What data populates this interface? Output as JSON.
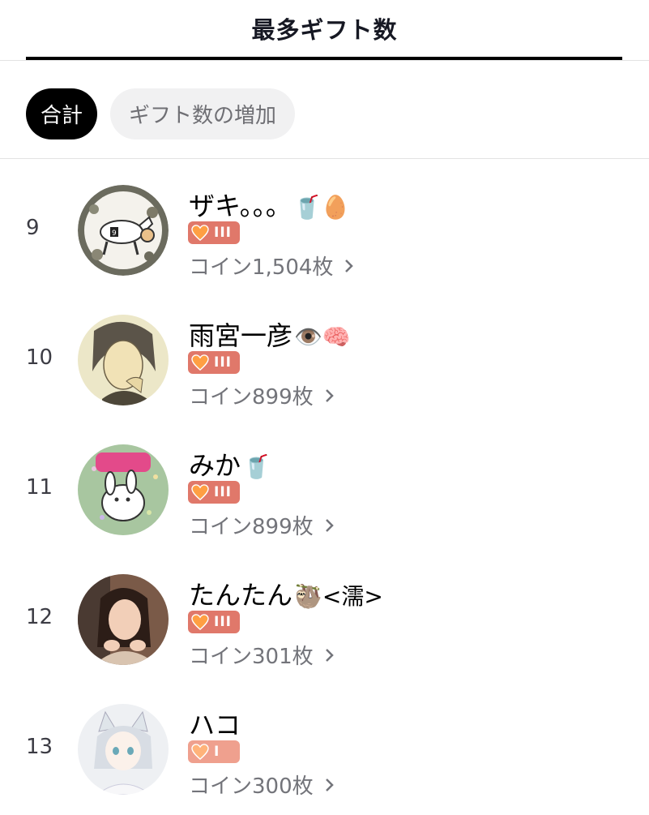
{
  "header": {
    "title": "最多ギフト数"
  },
  "filters": {
    "active_label": "合計",
    "inactive_label": "ギフト数の増加"
  },
  "rows": [
    {
      "rank": "9",
      "name": "ザキ。。。",
      "emojis": "🥤🥚",
      "level": "III",
      "coins": "コイン1,504枚",
      "avatar": "horse-illustration"
    },
    {
      "rank": "10",
      "name": "雨宮一彦",
      "emojis": "👁️🧠",
      "level": "III",
      "coins": "コイン899枚",
      "avatar": "sketch-portrait"
    },
    {
      "rank": "11",
      "name": "みか",
      "emojis": "🥤",
      "level": "III",
      "coins": "コイン899枚",
      "avatar": "bunny-illustration"
    },
    {
      "rank": "12",
      "name": "たんたん",
      "emojis": "🦥<濡>",
      "level": "III",
      "coins": "コイン301枚",
      "avatar": "woman-photo"
    },
    {
      "rank": "13",
      "name": "ハコ",
      "emojis": "",
      "level": "I",
      "coins": "コイン300枚",
      "avatar": "anime-character"
    }
  ],
  "colors": {
    "badge_high": "#e0786a",
    "badge_low": "#efa08e",
    "active_chip": "#000000",
    "accent_line": "#000000"
  }
}
